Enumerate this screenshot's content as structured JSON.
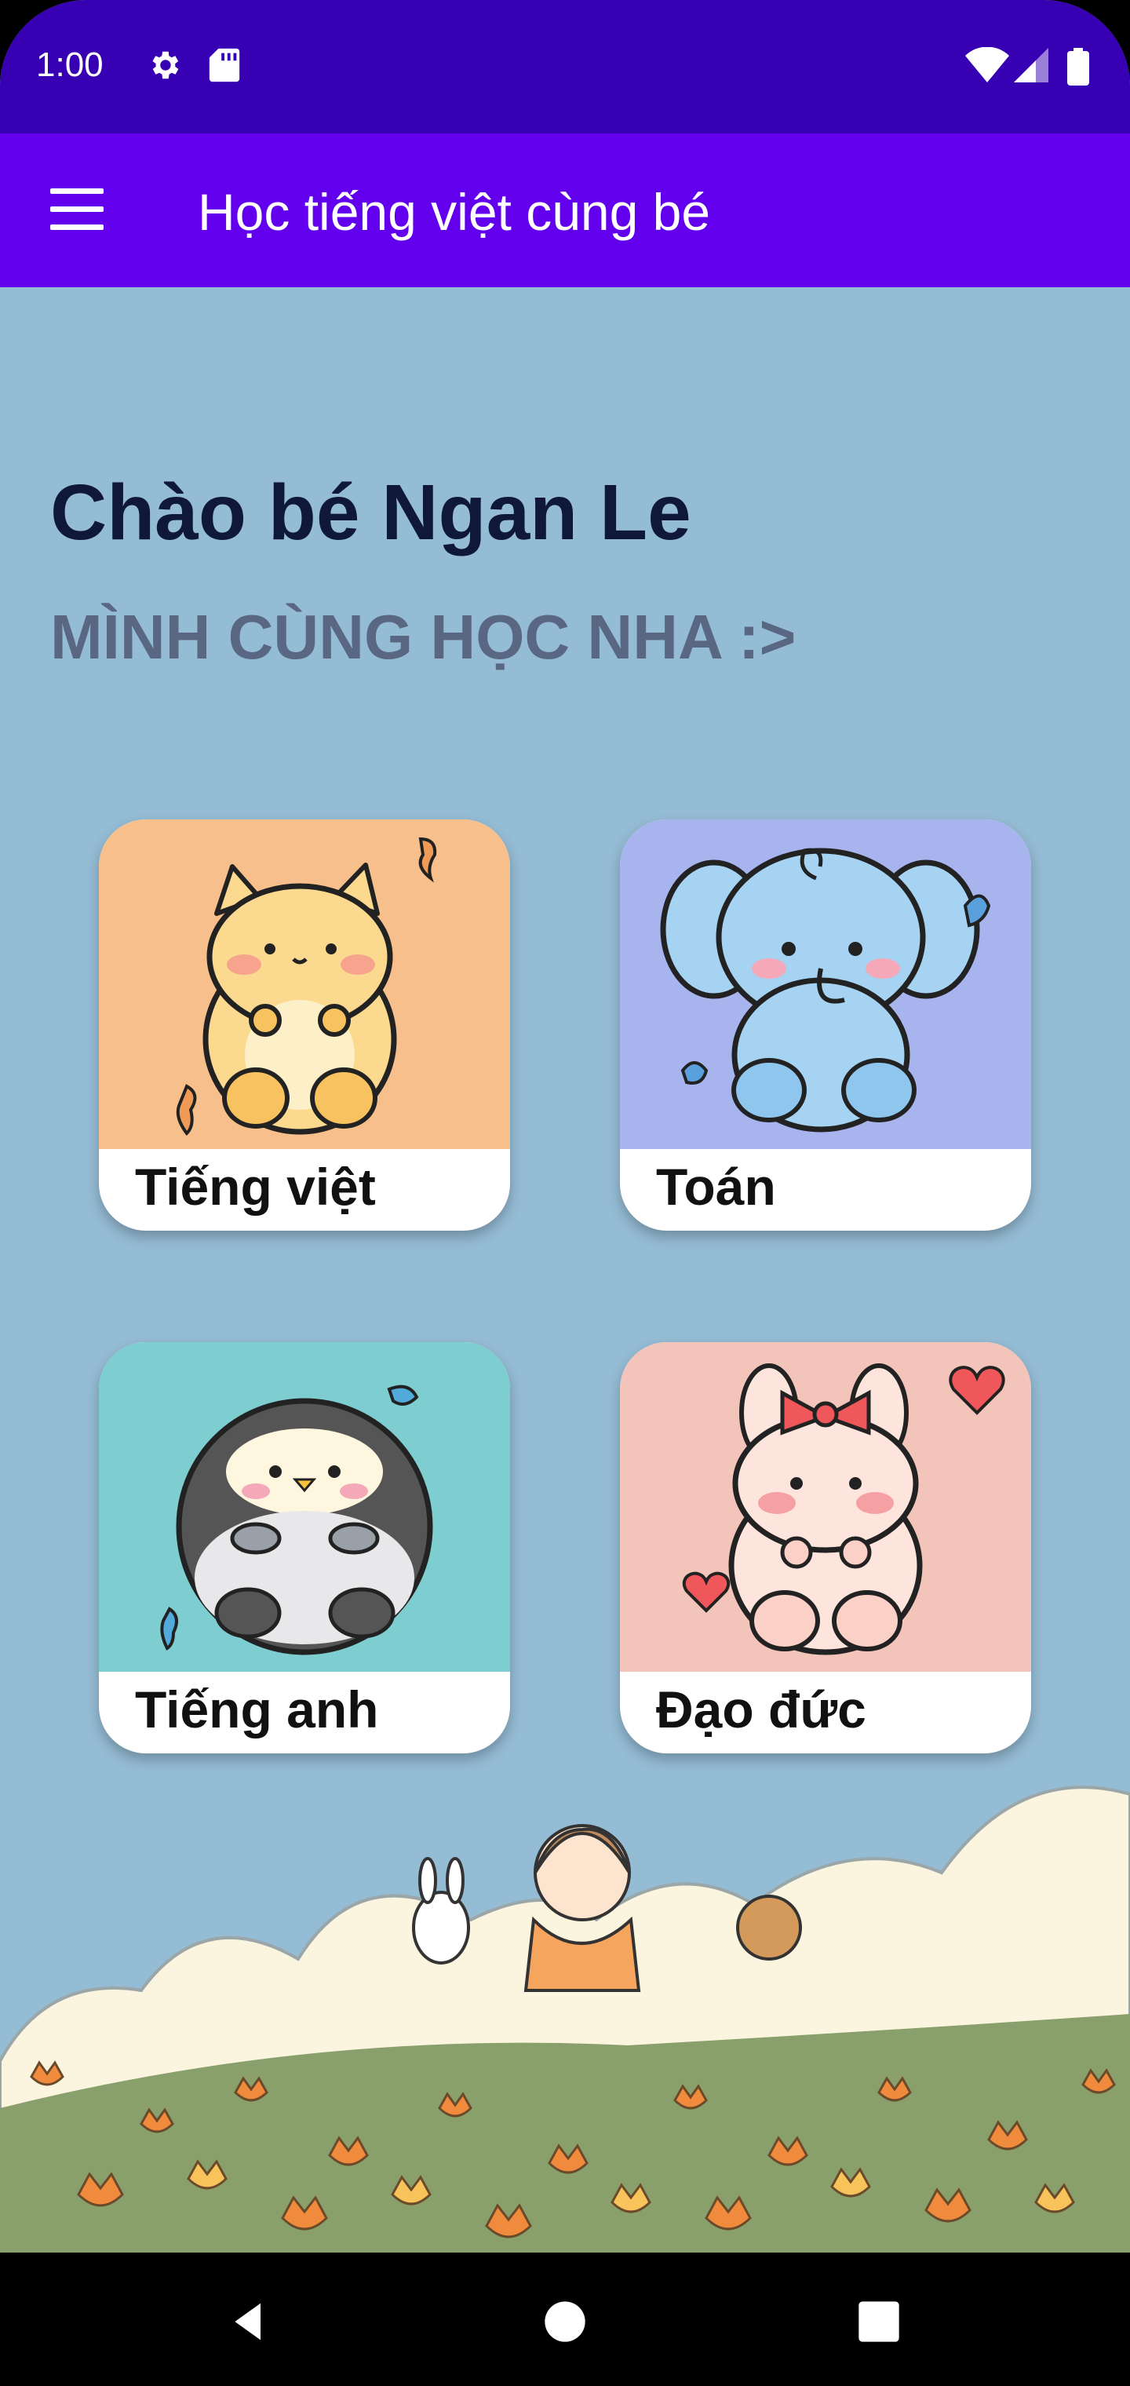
{
  "status_bar": {
    "time": "1:00",
    "icons": [
      "settings-icon",
      "sd-card-icon",
      "wifi-icon",
      "signal-icon",
      "battery-icon"
    ]
  },
  "app_bar": {
    "title": "Học tiếng việt cùng bé",
    "menu_icon": "hamburger-menu-icon"
  },
  "main": {
    "greeting": "Chào bé Ngan Le",
    "subtitle": "MÌNH CÙNG HỌC NHA :>",
    "subjects": [
      {
        "label": "Tiếng việt",
        "color": "#f6bf8b",
        "icon": "cat-illustration"
      },
      {
        "label": "Toán",
        "color": "#a8b4ee",
        "icon": "elephant-illustration"
      },
      {
        "label": "Tiếng anh",
        "color": "#7ecdd0",
        "icon": "penguin-illustration"
      },
      {
        "label": "Đạo đức",
        "color": "#f3c4b9",
        "icon": "bunny-illustration"
      }
    ]
  },
  "nav_bar": {
    "buttons": [
      "back-icon",
      "home-icon",
      "recents-icon"
    ]
  },
  "colors": {
    "status_bar": "#3700b3",
    "app_bar": "#6200ee",
    "background": "#95bcd5",
    "greeting": "#101838",
    "subtitle": "#5a6783"
  }
}
